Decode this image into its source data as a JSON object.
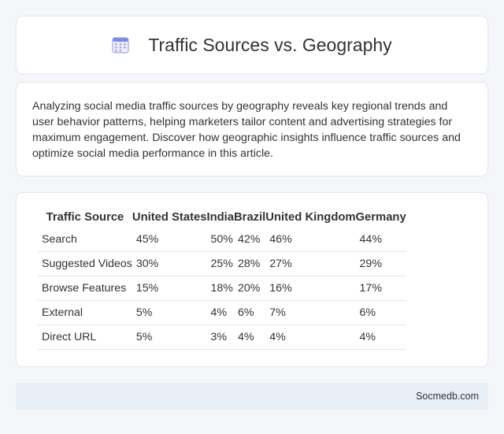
{
  "header": {
    "title": "Traffic Sources vs. Geography",
    "icon": "calendar-icon",
    "icon_color": "#7b8fe0"
  },
  "intro": {
    "text": "Analyzing social media traffic sources by geography reveals key regional trends and user behavior patterns, helping marketers tailor content and advertising strategies for maximum engagement. Discover how geographic insights influence traffic sources and optimize social media performance in this article."
  },
  "table": {
    "headers": [
      "Traffic Source",
      "United States",
      "India",
      "Brazil",
      "United Kingdom",
      "Germany"
    ],
    "rows": [
      [
        "Search",
        "45%",
        "50%",
        "42%",
        "46%",
        "44%"
      ],
      [
        "Suggested Videos",
        "30%",
        "25%",
        "28%",
        "27%",
        "29%"
      ],
      [
        "Browse Features",
        "15%",
        "18%",
        "20%",
        "16%",
        "17%"
      ],
      [
        "External",
        "5%",
        "4%",
        "6%",
        "7%",
        "6%"
      ],
      [
        "Direct URL",
        "5%",
        "3%",
        "4%",
        "4%",
        "4%"
      ]
    ]
  },
  "footer": {
    "brand": "Socmedb.com"
  }
}
